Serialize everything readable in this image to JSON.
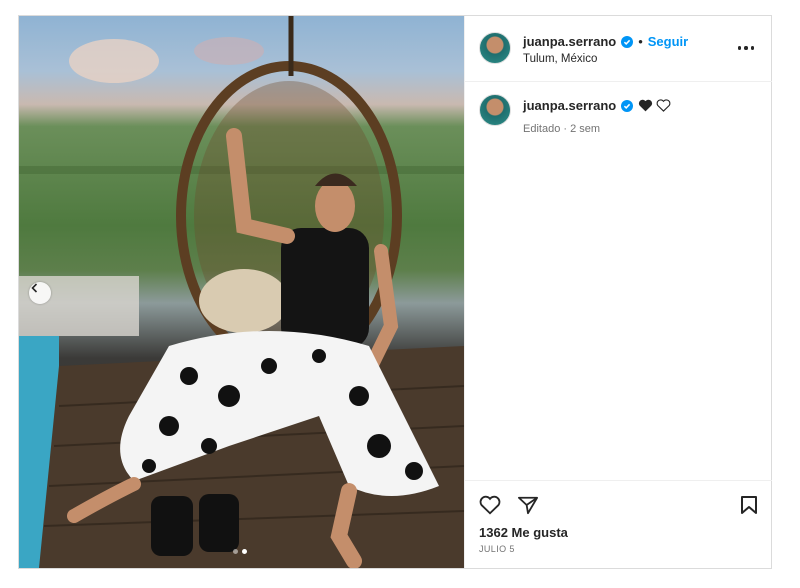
{
  "post": {
    "header": {
      "username": "juanpa.serrano",
      "separator": "•",
      "follow_label": "Seguir",
      "location": "Tulum, México"
    },
    "caption": {
      "username": "juanpa.serrano",
      "meta": "Editado · 2 sem"
    },
    "stats": {
      "likes_text": "1362 Me gusta",
      "date": "JULIO 5"
    },
    "carousel": {
      "current_index": 2,
      "total": 2
    },
    "colors": {
      "accent": "#0095f6",
      "text": "#262626",
      "muted": "#737373",
      "border": "#dbdbdb"
    },
    "icons": [
      "chevron-left-icon",
      "verified-icon",
      "more-icon",
      "black-heart-icon",
      "white-heart-icon",
      "heart-icon",
      "share-icon",
      "bookmark-icon"
    ]
  }
}
